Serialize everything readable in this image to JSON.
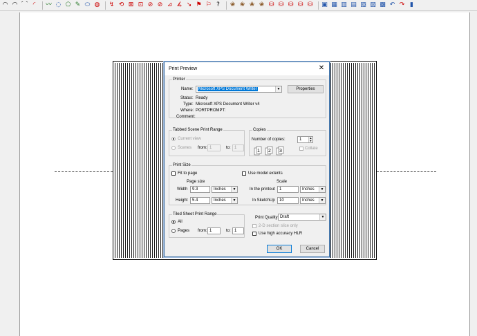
{
  "toolbar": {
    "icons": [
      "arc-icon",
      "arc-icon",
      "arc-icon",
      "arc-icon",
      "freehand-icon",
      "circle-icon",
      "polygon-icon",
      "eraser-icon",
      "ellipse-icon",
      "lasso-icon",
      "move-icon",
      "rotate-icon",
      "offset-icon",
      "scale-icon",
      "pushpull-icon",
      "followme-icon",
      "tape-icon",
      "protractor-icon",
      "dimension-icon",
      "text-icon",
      "axes-icon",
      "3dtext-icon",
      "camera-icon",
      "section-icon",
      "paint-icon",
      "paint-icon",
      "paint-icon",
      "layer-icon",
      "layer-icon",
      "component-icon",
      "component-icon",
      "component-icon",
      "component-icon",
      "camera-icon",
      "walk-icon",
      "look-icon",
      "view-icon",
      "view-icon",
      "view-icon",
      "view-icon",
      "view-icon",
      "view-icon",
      "view-icon"
    ]
  },
  "dialog": {
    "title": "Print Preview",
    "close": "✕",
    "printer": {
      "group_label": "Printer",
      "name_label": "Name:",
      "name_value": "Microsoft XPS Document Writer",
      "properties_button": "Properties",
      "status_label": "Status:",
      "status_value": "Ready",
      "type_label": "Type:",
      "type_value": "Microsoft XPS Document Writer v4",
      "where_label": "Where:",
      "where_value": "PORTPROMPT:",
      "comment_label": "Comment:",
      "comment_value": ""
    },
    "tabbed_scene": {
      "group_label": "Tabbed Scene Print Range",
      "current_view": "Current view",
      "scenes": "Scenes",
      "from_label": "from:",
      "from_value": "1",
      "to_label": "to:",
      "to_value": "1"
    },
    "copies": {
      "group_label": "Copies",
      "number_label": "Number of copies:",
      "number_value": "1",
      "collate": "Collate"
    },
    "print_size": {
      "group_label": "Print Size",
      "fit_to_page": "Fit to page",
      "use_model_extents": "Use model extents",
      "page_size_header": "Page size",
      "scale_header": "Scale",
      "width_label": "Width",
      "width_value": "9.3",
      "width_unit": "Inches",
      "height_label": "Height",
      "height_value": "5.4",
      "height_unit": "Inches",
      "in_printout_label": "In the printout",
      "in_printout_value": "1",
      "in_printout_unit": "Inches",
      "in_sketchup_label": "In SketchUp",
      "in_sketchup_value": "10",
      "in_sketchup_unit": "Inches"
    },
    "tiled_sheet": {
      "group_label": "Tiled Sheet Print Range",
      "all": "All",
      "pages": "Pages",
      "from_label": "from:",
      "from_value": "1",
      "to_label": "to:",
      "to_value": "1"
    },
    "quality": {
      "label": "Print Quality",
      "value": "Draft",
      "section_slice": "2-D section slice only",
      "high_accuracy": "Use high accuracy HLR"
    },
    "ok_button": "OK",
    "cancel_button": "Cancel"
  }
}
